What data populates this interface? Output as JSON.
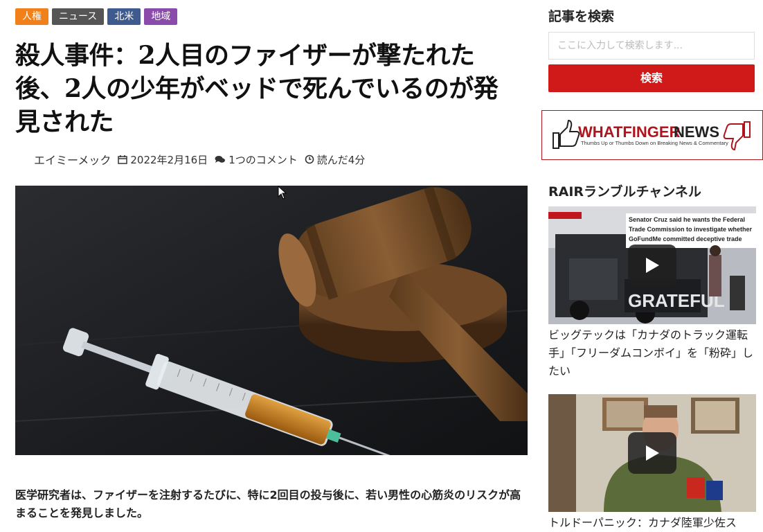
{
  "categories": [
    {
      "label": "人権",
      "color": "#f0801a"
    },
    {
      "label": "ニュース",
      "color": "#555555"
    },
    {
      "label": "北米",
      "color": "#3f5a8c"
    },
    {
      "label": "地域",
      "color": "#8a4bab"
    }
  ],
  "article": {
    "title": "殺人事件：2人目のファイザーが撃たれた後、2人の少年がベッドで死んでいるのが発見された",
    "author": "エイミーメック",
    "date": "2022年2月16日",
    "comments": "1つのコメント",
    "read_time": "読んだ4分",
    "lead": "医学研究者は、ファイザーを注射するたびに、特に2回目の投与後に、若い男性の心筋炎のリスクが高まることを発見しました。"
  },
  "sidebar": {
    "search_title": "記事を検索",
    "search_placeholder": "ここに入力して検索します...",
    "search_button": "検索",
    "ad": {
      "brand_a": "WHATFINGER",
      "brand_b": "NEWS",
      "tagline": "Thumbs Up or Thumbs Down on Breaking News & Commentary"
    },
    "rumble_title": "RAIRランブルチャンネル",
    "videos": [
      {
        "overlay_lines": [
          "Senator Cruz said he wants the Federal",
          "Trade Commission to investigate whether",
          "GoFundMe committed deceptive trade"
        ],
        "truck_text": "GRATEFUL",
        "caption": "ビッグテックは「カナダのトラック運転手」「フリーダムコンボイ」を「粉砕」したい"
      },
      {
        "caption": "トルドーパニック：カナダ陸軍少佐ス"
      }
    ]
  }
}
